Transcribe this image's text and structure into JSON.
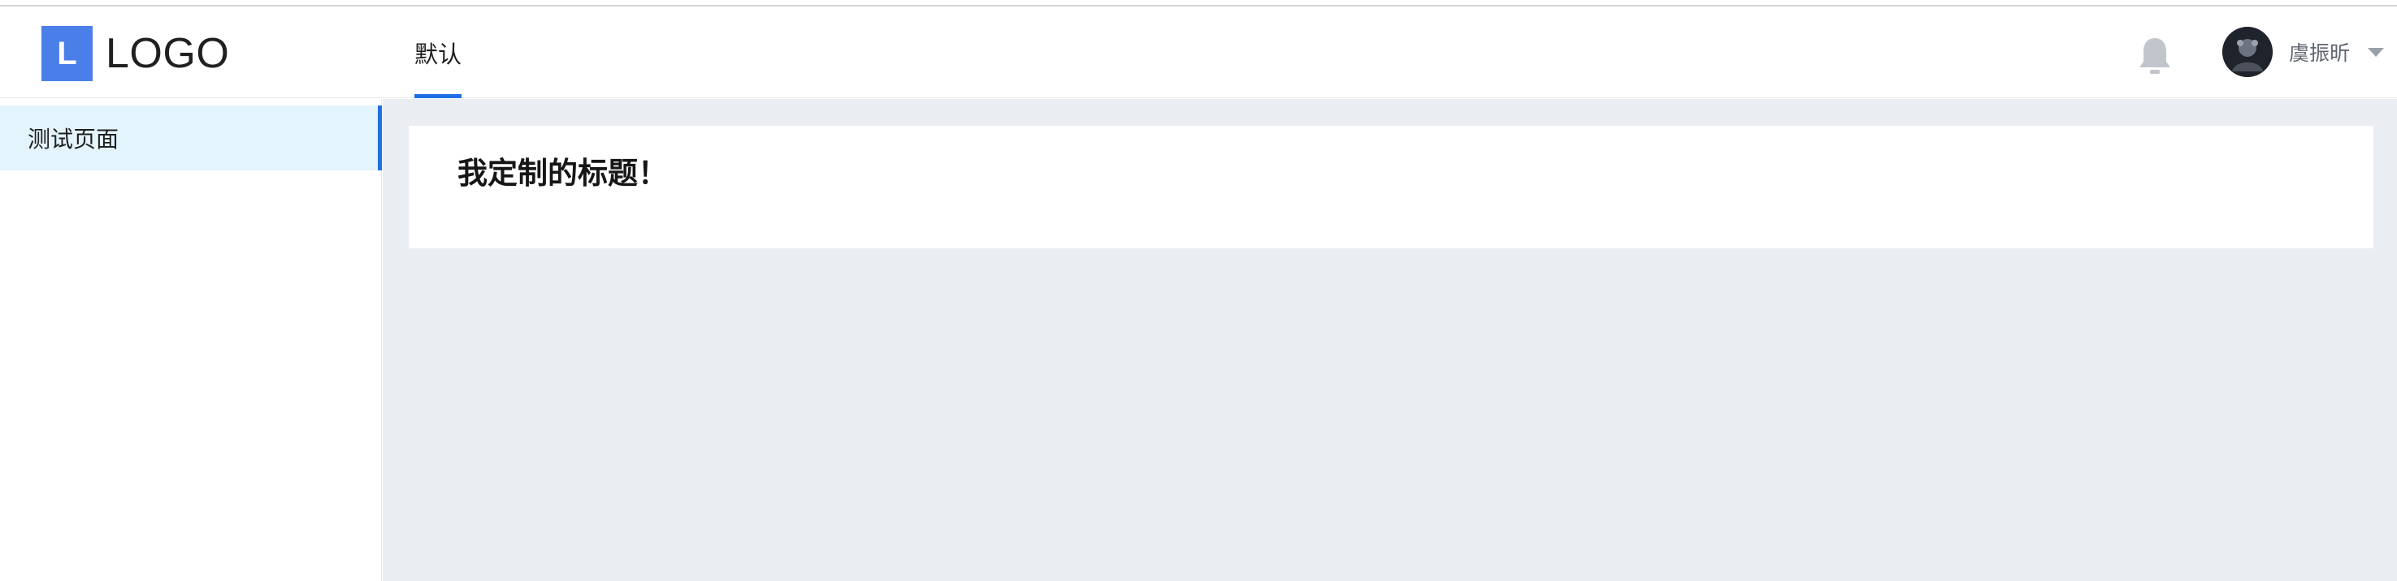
{
  "header": {
    "logo": {
      "mark": "L",
      "text": "LOGO"
    },
    "nav": {
      "active_tab": "默认"
    },
    "notification_icon": "bell-icon",
    "user": {
      "name": "虞振昕",
      "dropdown_icon": "caret-down-icon"
    }
  },
  "sidebar": {
    "items": [
      {
        "label": "测试页面",
        "active": true
      }
    ]
  },
  "main": {
    "card": {
      "title": "我定制的标题！"
    }
  },
  "colors": {
    "accent": "#1f6fe5",
    "logo_blue": "#4a7ee8",
    "active_menu_bg": "#e4f4fd",
    "content_bg": "#eaedf2"
  }
}
